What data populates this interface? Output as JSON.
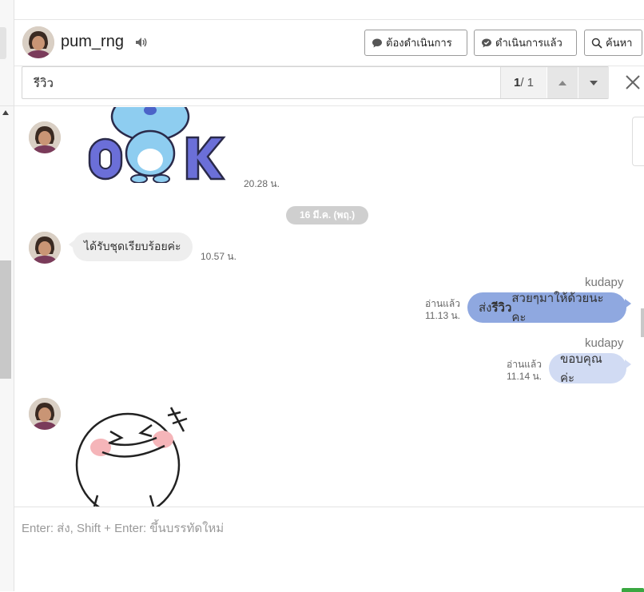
{
  "header": {
    "contact_name": "pum_rng",
    "buttons": {
      "pending": "ต้องดำเนินการ",
      "done": "ดำเนินการแล้ว",
      "search": "ค้นหา"
    }
  },
  "search": {
    "query": "รีวิว",
    "current": "1",
    "total": "/ 1"
  },
  "messages": {
    "sticker_time": "20.28 น.",
    "date_divider": "16 มี.ค. (พฤ.)",
    "incoming_text": "ได้รับชุดเรียบร้อยค่ะ",
    "incoming_time": "10.57 น.",
    "out1": {
      "sender": "kudapy",
      "read": "อ่านแล้ว",
      "time": "11.13 น.",
      "prefix": "ส่ง",
      "highlight": "รีวิว",
      "suffix": "สวยๆมาให้ด้วยนะคะ"
    },
    "out2": {
      "sender": "kudapy",
      "read": "อ่านแล้ว",
      "time": "11.14 น.",
      "text": "ขอบคุณค่ะ"
    }
  },
  "composer": {
    "placeholder": "Enter: ส่ง, Shift + Enter: ขึ้นบรรทัดใหม่"
  },
  "colors": {
    "outgoing_bubble": "#8fa8e0",
    "outgoing_bubble_light": "#d1dbf3",
    "incoming_bubble": "#eeeeee",
    "send_accent": "#3aa741"
  }
}
